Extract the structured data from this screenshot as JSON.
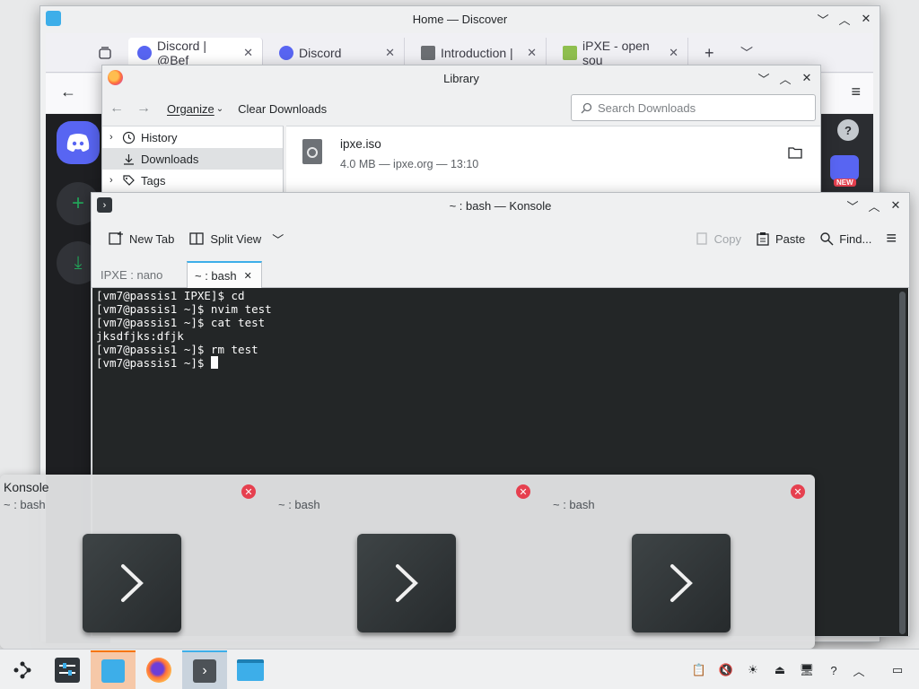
{
  "discover": {
    "title": "Home — Discover",
    "tabs": [
      {
        "label": "Discord | @Bef"
      },
      {
        "label": "Discord"
      },
      {
        "label": "Introduction | "
      },
      {
        "label": "iPXE - open sou"
      }
    ],
    "discord_badge": "NEW",
    "colors": {
      "discord_blurple": "#5865f2",
      "discord_bg": "#1e1f22",
      "discord_green": "#23a55a"
    }
  },
  "library": {
    "title": "Library",
    "organize_label": "Organize",
    "clear_label": "Clear Downloads",
    "search_placeholder": "Search Downloads",
    "sidebar": [
      {
        "label": "History",
        "icon": "clock-icon"
      },
      {
        "label": "Downloads",
        "icon": "download-icon"
      },
      {
        "label": "Tags",
        "icon": "tag-icon"
      }
    ],
    "download": {
      "name": "ipxe.iso",
      "meta": "4.0 MB — ipxe.org — 13:10"
    }
  },
  "konsole": {
    "title": "~ : bash — Konsole",
    "toolbar": {
      "new_tab": "New Tab",
      "split_view": "Split View",
      "copy": "Copy",
      "paste": "Paste",
      "find": "Find..."
    },
    "tabs": [
      {
        "label": "IPXE : nano",
        "active": false
      },
      {
        "label": "~ : bash",
        "active": true
      }
    ],
    "terminal_lines": [
      "[vm7@passis1 IPXE]$ cd",
      "[vm7@passis1 ~]$ nvim test",
      "[vm7@passis1 ~]$ cat test",
      "jksdfjks:dfjk",
      "[vm7@passis1 ~]$ rm test",
      "[vm7@passis1 ~]$ "
    ],
    "colors": {
      "terminal_bg": "#232627",
      "terminal_fg": "#fcfcfc"
    }
  },
  "switcher": {
    "items": [
      {
        "title": "Konsole",
        "subtitle": "~ : bash"
      },
      {
        "title": "",
        "subtitle": "~ : bash"
      },
      {
        "title": "",
        "subtitle": "~ : bash"
      }
    ],
    "colors": {
      "close": "#e6404f"
    }
  },
  "taskbar": {
    "apps": [
      {
        "name": "launcher",
        "icon": "launcher-icon"
      },
      {
        "name": "system-settings",
        "icon": "settings-icon"
      },
      {
        "name": "discover",
        "icon": "discover-icon"
      },
      {
        "name": "firefox",
        "icon": "firefox-icon"
      },
      {
        "name": "konsole",
        "icon": "konsole-icon"
      },
      {
        "name": "dolphin",
        "icon": "folder-icon"
      }
    ],
    "tray": [
      "clipboard-icon",
      "volume-muted-icon",
      "brightness-icon",
      "usb-icon",
      "display-icon",
      "help-icon",
      "expand-tray-icon",
      "show-desktop-icon"
    ]
  }
}
